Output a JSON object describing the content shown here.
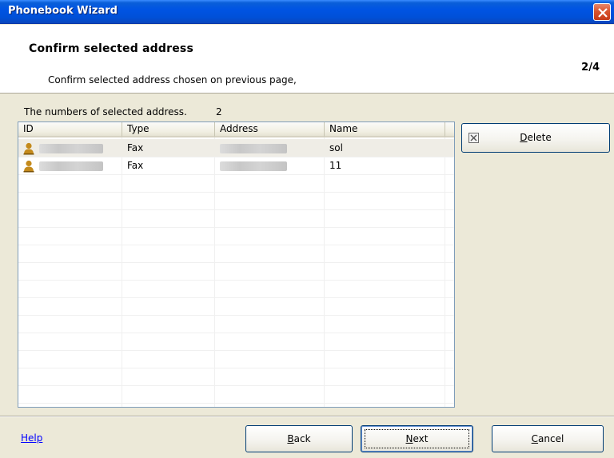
{
  "window": {
    "title": "Phonebook Wizard",
    "accent_color": "#0054e3",
    "close_color": "#d9542e"
  },
  "header": {
    "title": "Confirm selected address",
    "step": "2/4",
    "description": "Confirm selected address chosen on previous page,"
  },
  "summary": {
    "label": "The numbers of selected address.",
    "count": "2"
  },
  "table": {
    "columns": [
      "ID",
      "Type",
      "Address",
      "Name"
    ],
    "rows": [
      {
        "icon": "person-icon",
        "id": "",
        "type": "Fax",
        "address": "",
        "name": "sol",
        "selected": true
      },
      {
        "icon": "person-icon",
        "id": "",
        "type": "Fax",
        "address": "",
        "name": "11",
        "selected": false
      }
    ]
  },
  "actions": {
    "delete_prefix": "D",
    "delete_rest": "elete",
    "delete_icon": "delete-icon"
  },
  "footer": {
    "help": "Help",
    "back_prefix": "B",
    "back_rest": "ack",
    "next_prefix": "N",
    "next_rest": "ext",
    "cancel_prefix": "C",
    "cancel_rest": "ancel"
  }
}
